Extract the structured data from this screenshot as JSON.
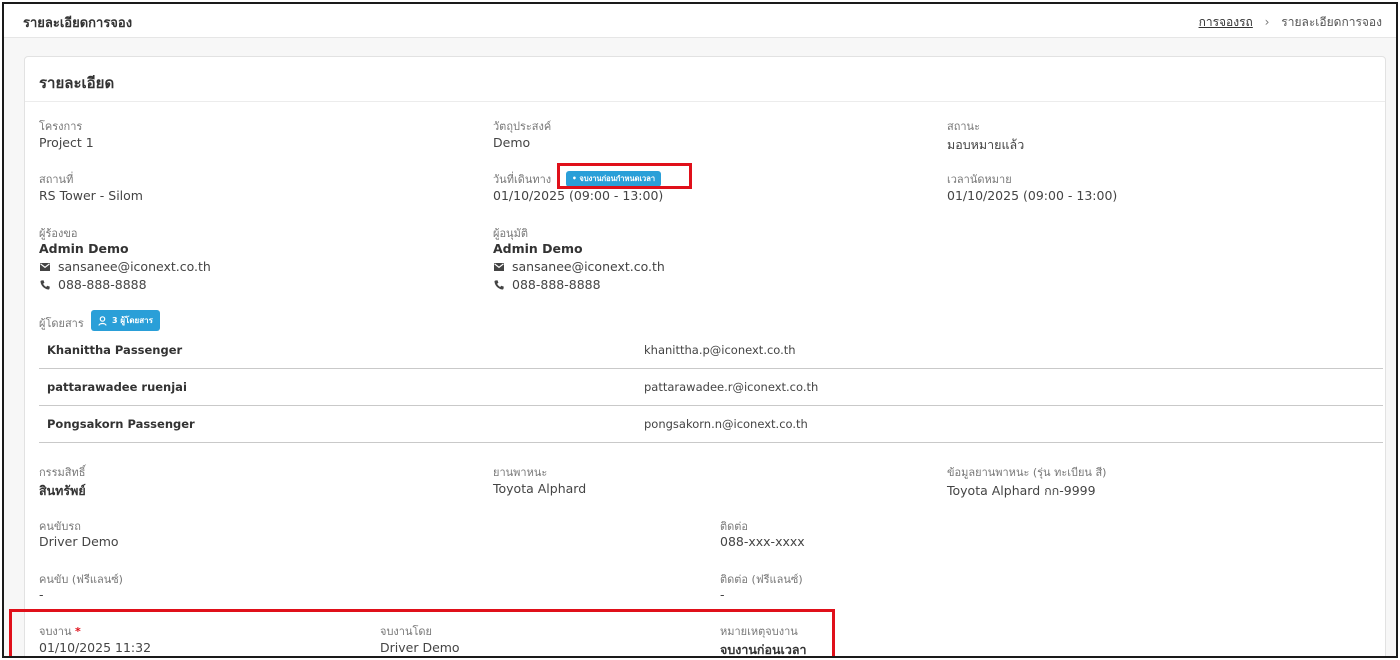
{
  "page": {
    "title": "รายละเอียดการจอง",
    "breadcrumb": {
      "link": "การจองรถ",
      "separator": "›",
      "current": "รายละเอียดการจอง"
    }
  },
  "card": {
    "title": "รายละเอียด"
  },
  "project": {
    "label": "โครงการ",
    "value": "Project 1"
  },
  "purpose": {
    "label": "วัตถุประสงค์",
    "value": "Demo"
  },
  "status": {
    "label": "สถานะ",
    "value": "มอบหมายแล้ว"
  },
  "location": {
    "label": "สถานที่",
    "value": "RS Tower - Silom"
  },
  "travel_date": {
    "label": "วันที่เดินทาง",
    "badge": "จบงานก่อนกำหนดเวลา",
    "value": "01/10/2025 (09:00 - 13:00)"
  },
  "appointment": {
    "label": "เวลานัดหมาย",
    "value": "01/10/2025 (09:00 - 13:00)"
  },
  "requester": {
    "label": "ผู้ร้องขอ",
    "name": "Admin Demo",
    "email": "sansanee@iconext.co.th",
    "phone": "088-888-8888"
  },
  "approver": {
    "label": "ผู้อนุมัติ",
    "name": "Admin Demo",
    "email": "sansanee@iconext.co.th",
    "phone": "088-888-8888"
  },
  "passengers": {
    "label": "ผู้โดยสาร",
    "badge": "3 ผู้โดยสาร",
    "rows": [
      {
        "name": "Khanittha Passenger",
        "email": "khanittha.p@iconext.co.th"
      },
      {
        "name": "pattarawadee ruenjai",
        "email": "pattarawadee.r@iconext.co.th"
      },
      {
        "name": "Pongsakorn Passenger",
        "email": "pongsakorn.n@iconext.co.th"
      }
    ]
  },
  "ownership": {
    "label": "กรรมสิทธิ์",
    "value": "สินทรัพย์"
  },
  "vehicle": {
    "label": "ยานพาหนะ",
    "value": "Toyota Alphard"
  },
  "vehicle_info": {
    "label": "ข้อมูลยานพาหนะ (รุ่น ทะเบียน สี)",
    "value": "Toyota Alphard กก-9999"
  },
  "driver": {
    "label": "คนขับรถ",
    "value": "Driver Demo"
  },
  "driver_contact": {
    "label": "ติดต่อ",
    "value": "088-xxx-xxxx"
  },
  "freelance_driver": {
    "label": "คนขับ (ฟรีแลนซ์)",
    "value": "-"
  },
  "freelance_contact": {
    "label": "ติดต่อ (ฟรีแลนซ์)",
    "value": "-"
  },
  "job_end": {
    "label": "จบงาน",
    "required_mark": "*",
    "value": "01/10/2025 11:32"
  },
  "ended_by": {
    "label": "จบงานโดย",
    "value": "Driver Demo"
  },
  "end_note": {
    "label": "หมายเหตุจบงาน",
    "value": "จบงานก่อนเวลา"
  },
  "colors": {
    "accent": "#2a9fd8",
    "highlight": "#e0101a",
    "border": "#1a1a1a"
  },
  "icons": {
    "breadcrumb_sep": "chevron-right-icon",
    "email": "envelope-icon",
    "phone": "phone-icon",
    "passenger": "person-icon"
  }
}
